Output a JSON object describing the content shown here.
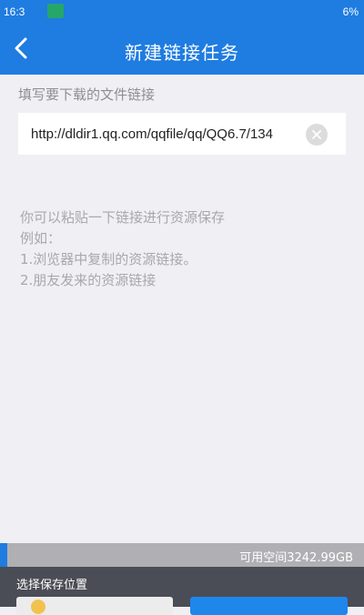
{
  "status_bar": {
    "time": "16:3",
    "battery": "6%"
  },
  "nav": {
    "title": "新建链接任务"
  },
  "form": {
    "label": "填写要下载的文件链接",
    "url_value": "http://dldir1.qq.com/qqfile/qq/QQ6.7/134"
  },
  "hint": {
    "lines": [
      "你可以粘贴一下链接进行资源保存",
      "例如：",
      "1.浏览器中复制的资源链接。",
      "2.朋友发来的资源链接"
    ]
  },
  "storage": {
    "label": "可用空间3242.99GB",
    "used_fraction": 0.02
  },
  "bottom": {
    "save_location_label": "选择保存位置"
  },
  "colors": {
    "accent": "#1f7ce0",
    "background": "#efeff4",
    "bottom_panel": "#4a4d55"
  }
}
